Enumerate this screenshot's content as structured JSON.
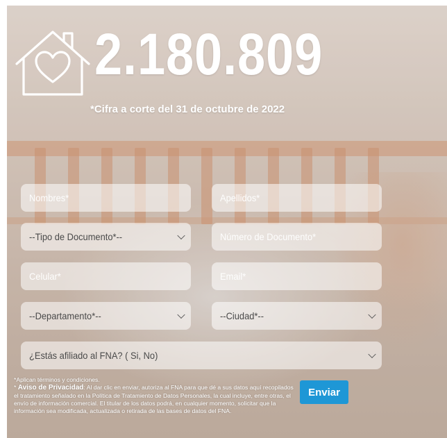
{
  "hero": {
    "count": "2.180.809",
    "count_note": "*Cifra a corte del 31 de octubre de 2022"
  },
  "form": {
    "nombres": {
      "placeholder": "Nombres*"
    },
    "apellidos": {
      "placeholder": "Apellidos*"
    },
    "tipo_documento": {
      "selected": "--Tipo de Documento*--"
    },
    "numero_documento": {
      "placeholder": "Número de Documento*"
    },
    "celular": {
      "placeholder": "Celular*"
    },
    "email": {
      "placeholder": "Email*"
    },
    "departamento": {
      "selected": "--Departamento*--"
    },
    "ciudad": {
      "selected": "--Ciudad*--"
    },
    "afiliado": {
      "selected": "¿Estás afiliado al FNA? ( Si, No)"
    },
    "submit_label": "Enviar"
  },
  "legal": {
    "terms": "*Aplican términos y condiciones.",
    "privacy_prefix": "* ",
    "privacy_title": "Aviso de Privacidad",
    "privacy_text": ": Al dar clic en enviar, autoriza al FNA para que dé a sus datos aquí recopilados el tratamiento señalado en la Política de Tratamiento de Datos Personales, la cual incluye, entre otras, el envío de información comercial. El titular de los datos podrá, en cualquier momento, solicitar que la información sea modificada, actualizada o retirada de las bases de datos del FNA."
  },
  "colors": {
    "submit_button": "#1e97d6",
    "text_on_hero": "#ffffff"
  },
  "icons": {
    "house": "house-heart-icon",
    "chevron": "chevron-down-icon"
  }
}
